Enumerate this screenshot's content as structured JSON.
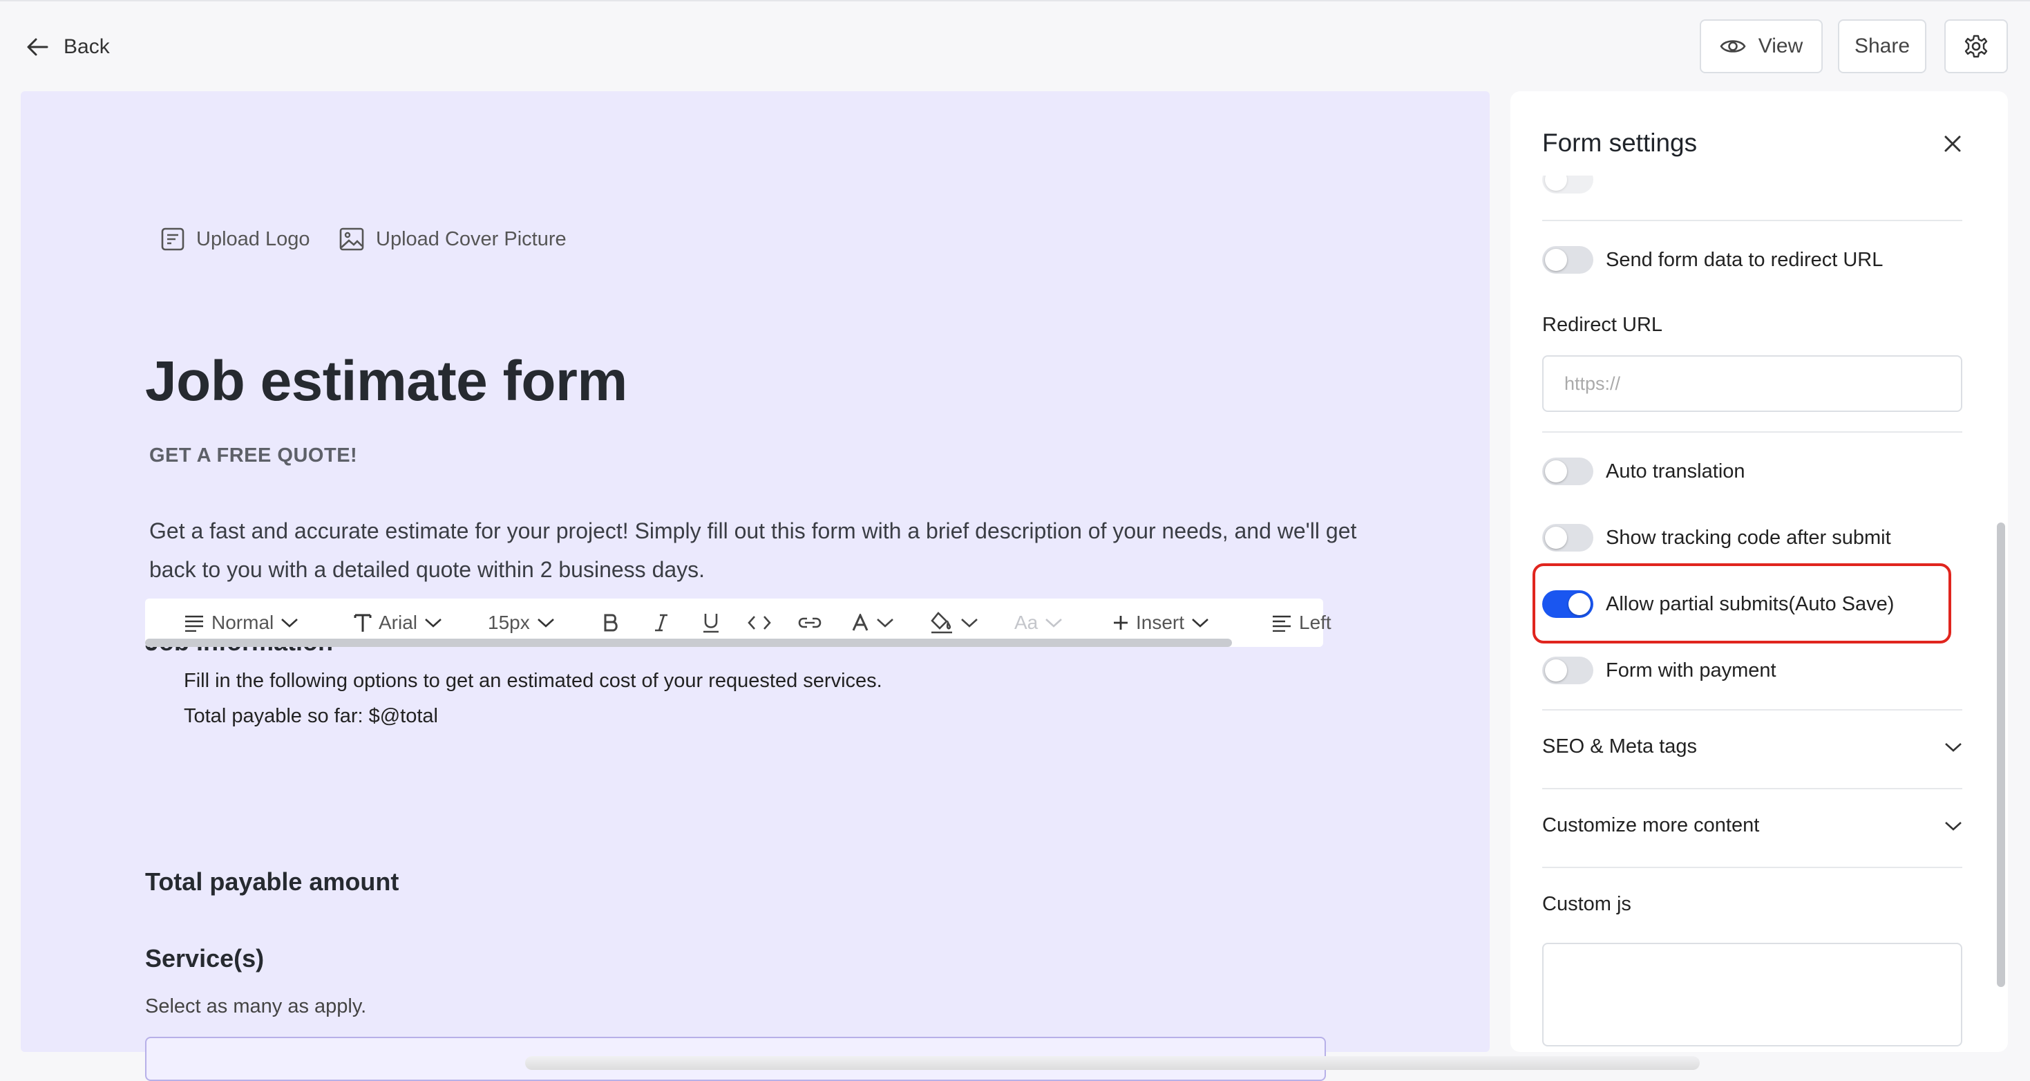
{
  "header": {
    "back_label": "Back",
    "view_label": "View",
    "share_label": "Share"
  },
  "canvas": {
    "upload_logo": "Upload Logo",
    "upload_cover": "Upload Cover Picture",
    "title": "Job estimate form",
    "subtitle": "GET A FREE QUOTE!",
    "description": "Get a fast and accurate estimate for your project! Simply fill out this form with a brief description of your needs, and we'll get back to you with a detailed quote within 2 business days.",
    "section_job": "Job information",
    "toolbar": {
      "paragraph": "Normal",
      "font": "Arial",
      "size": "15px",
      "case": "Aa",
      "insert": "Insert",
      "align": "Left"
    },
    "richtext_line1": "Fill in the following options to get an estimated cost of your requested services.",
    "richtext_line2": "Total payable so far: $@total",
    "section_total": "Total payable amount",
    "section_services": "Service(s)",
    "services_hint": "Select as many as apply."
  },
  "panel": {
    "title": "Form settings",
    "toggles": {
      "send_form_data": {
        "label": "Send form data to redirect URL",
        "on": false
      },
      "auto_translation": {
        "label": "Auto translation",
        "on": false
      },
      "tracking_code": {
        "label": "Show tracking code after submit",
        "on": false
      },
      "partial_submits": {
        "label": "Allow partial submits(Auto Save)",
        "on": true
      },
      "payment": {
        "label": "Form with payment",
        "on": false
      }
    },
    "redirect_label": "Redirect URL",
    "redirect_placeholder": "https://",
    "seo_label": "SEO & Meta tags",
    "customize_label": "Customize more content",
    "custom_js_label": "Custom js"
  },
  "colors": {
    "canvas_bg": "#ebe9fd",
    "toggle_on": "#1a56f0",
    "highlight": "#e0251e"
  }
}
